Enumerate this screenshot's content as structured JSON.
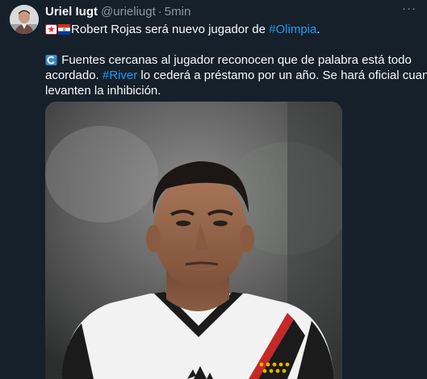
{
  "tweet": {
    "author_name": "Uriel Iugt",
    "handle": "@urieliugt",
    "separator": "·",
    "time": "5min",
    "more_icon": "ellipsis-icon",
    "line1_text": "Robert Rojas será nuevo jugador de ",
    "hashtag1": "#Olimpia",
    "line1_end": ".",
    "line2_text": " Fuentes cercanas al jugador reconocen que de palabra está todo",
    "line3_start": "acordado. ",
    "hashtag2": "#River",
    "line3_end": " lo cederá a préstamo por un año. Se hará oficial cuando",
    "line4_text": "levanten la inhibición.",
    "emoji_icons": [
      "olimpia-badge-icon",
      "paraguay-flag-icon",
      "repeat-arrow-icon"
    ]
  },
  "colors": {
    "background": "#15202b",
    "text": "#f7f9f9",
    "secondary": "#8b98a5",
    "link": "#1d9bf0"
  }
}
